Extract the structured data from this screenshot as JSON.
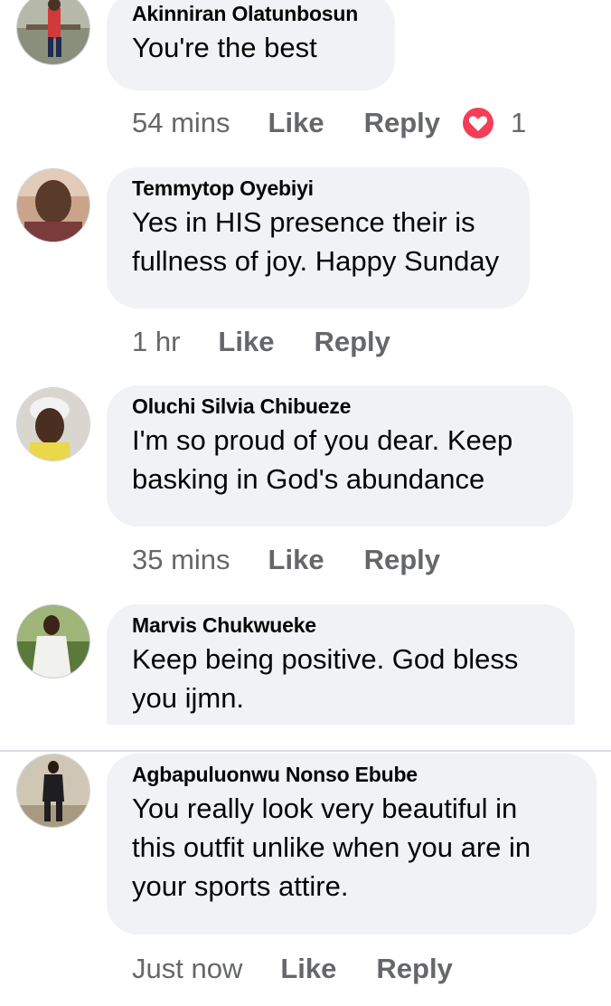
{
  "comments": [
    {
      "author": "Akinniran Olatunbosun",
      "lines": [
        "You're the best"
      ],
      "time": "54 mins",
      "like": "Like",
      "reply": "Reply",
      "reaction_count": "1",
      "reaction_icon": "love-heart-icon"
    },
    {
      "author": "Temmytop Oyebiyi",
      "lines": [
        "Yes in HIS presence their is",
        "fullness of joy. Happy Sunday"
      ],
      "time": "1 hr",
      "like": "Like",
      "reply": "Reply"
    },
    {
      "author": "Oluchi Silvia Chibueze",
      "lines": [
        "I'm so proud of you dear. Keep",
        "basking in God's abundance"
      ],
      "time": "35 mins",
      "like": "Like",
      "reply": "Reply"
    },
    {
      "author": "Marvis Chukwueke",
      "lines": [
        "Keep being positive. God bless",
        "you ijmn."
      ]
    },
    {
      "author": "Agbapuluonwu Nonso Ebube",
      "lines": [
        "You really look very beautiful in",
        "this outfit unlike when you are in",
        "your sports attire."
      ],
      "time": "Just now",
      "like": "Like",
      "reply": "Reply"
    }
  ],
  "colors": {
    "bubble": "#f0f2f5",
    "meta_text": "#65676b",
    "love_reaction": "#f33e58"
  }
}
